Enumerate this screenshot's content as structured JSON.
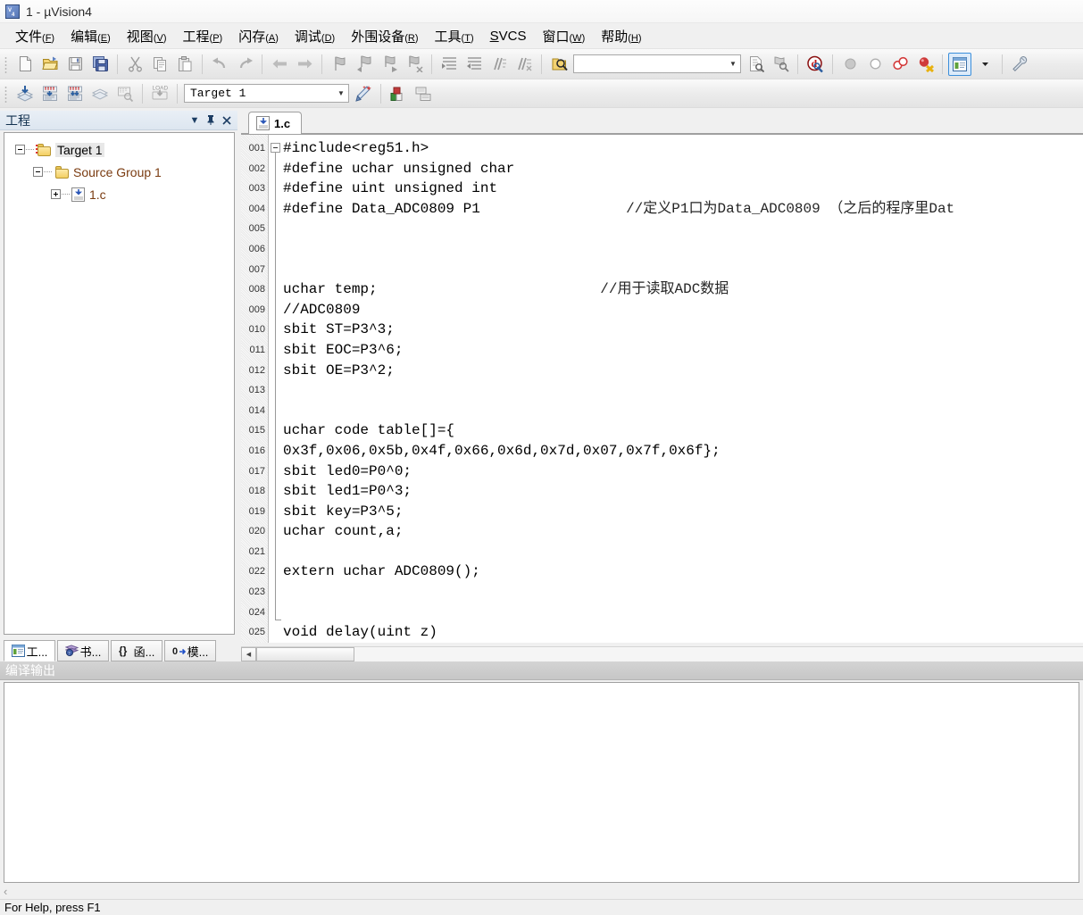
{
  "window": {
    "title": "1 - µVision4",
    "app_icon": "uvision-logo-icon"
  },
  "menubar": [
    {
      "name": "file",
      "label": "文件",
      "key": "F"
    },
    {
      "name": "edit",
      "label": "编辑",
      "key": "E"
    },
    {
      "name": "view",
      "label": "视图",
      "key": "V"
    },
    {
      "name": "project",
      "label": "工程",
      "key": "P"
    },
    {
      "name": "flash",
      "label": "闪存",
      "key": "A"
    },
    {
      "name": "debug",
      "label": "调试",
      "key": "D"
    },
    {
      "name": "peripherals",
      "label": "外围设备",
      "key": "R"
    },
    {
      "name": "tools",
      "label": "工具",
      "key": "T"
    },
    {
      "name": "svcs",
      "label": "SVCS",
      "key": "S",
      "inline_key": true
    },
    {
      "name": "window",
      "label": "窗口",
      "key": "W"
    },
    {
      "name": "help",
      "label": "帮助",
      "key": "H"
    }
  ],
  "toolbar_main": {
    "find_box": {
      "value": "",
      "placeholder": ""
    },
    "selected_button": "target-options-window-button"
  },
  "toolbar_build": {
    "target_combo": {
      "value": "Target 1"
    }
  },
  "project_panel": {
    "caption": "工程",
    "caption_buttons": [
      "dropdown-menu",
      "pin",
      "close"
    ],
    "tree": [
      {
        "label": "Target 1",
        "level": 0,
        "expander": "minus",
        "icon": "target-folder-icon",
        "selected": true
      },
      {
        "label": "Source Group 1",
        "level": 1,
        "expander": "minus",
        "icon": "group-folder-icon",
        "selected": false
      },
      {
        "label": "1.c",
        "level": 2,
        "expander": "plus",
        "icon": "c-source-file-icon",
        "selected": false
      }
    ],
    "tabs": [
      {
        "label": "工...",
        "icon": "project-icon",
        "active": true
      },
      {
        "label": "书...",
        "icon": "books-icon",
        "active": false
      },
      {
        "label": "函...",
        "icon": "functions-icon",
        "active": false
      },
      {
        "label": "模...",
        "icon": "templates-icon",
        "active": false
      }
    ]
  },
  "editor": {
    "tabs": [
      {
        "label": "1.c",
        "icon": "c-source-file-icon",
        "active": true
      }
    ],
    "fold_start_line": 1,
    "fold_end_line": 24,
    "lines": [
      {
        "n": "001",
        "code": "#include<reg51.h>"
      },
      {
        "n": "002",
        "code": "#define uchar unsigned char"
      },
      {
        "n": "003",
        "code": "#define uint unsigned int"
      },
      {
        "n": "004",
        "code": "#define Data_ADC0809 P1",
        "comment": "//定义P1口为Data_ADC0809 （之后的程序里Dat",
        "comment_col": 40
      },
      {
        "n": "005",
        "code": ""
      },
      {
        "n": "006",
        "code": ""
      },
      {
        "n": "007",
        "code": ""
      },
      {
        "n": "008",
        "code": "uchar temp;",
        "comment": "//用于读取ADC数据",
        "comment_col": 37
      },
      {
        "n": "009",
        "code": "//ADC0809"
      },
      {
        "n": "010",
        "code": "sbit ST=P3^3;"
      },
      {
        "n": "011",
        "code": "sbit EOC=P3^6;"
      },
      {
        "n": "012",
        "code": "sbit OE=P3^2;"
      },
      {
        "n": "013",
        "code": ""
      },
      {
        "n": "014",
        "code": ""
      },
      {
        "n": "015",
        "code": "uchar code table[]={"
      },
      {
        "n": "016",
        "code": "0x3f,0x06,0x5b,0x4f,0x66,0x6d,0x7d,0x07,0x7f,0x6f};"
      },
      {
        "n": "017",
        "code": "sbit led0=P0^0;"
      },
      {
        "n": "018",
        "code": "sbit led1=P0^3;"
      },
      {
        "n": "019",
        "code": "sbit key=P3^5;"
      },
      {
        "n": "020",
        "code": "uchar count,a;"
      },
      {
        "n": "021",
        "code": ""
      },
      {
        "n": "022",
        "code": "extern uchar ADC0809();"
      },
      {
        "n": "023",
        "code": ""
      },
      {
        "n": "024",
        "code": ""
      },
      {
        "n": "025",
        "code": "void delay(uint z)"
      }
    ]
  },
  "build_output": {
    "caption": "编译输出",
    "content": "",
    "scroll_marker": "‹"
  },
  "statusbar": {
    "text": "For Help, press F1"
  },
  "colors": {
    "accent_blue": "#3c8fdb",
    "tree_text": "#7a3b10",
    "caption_active_text": "#13314f",
    "build_caption_bg": "#c6c6c6",
    "editor_bg": "#ffffff",
    "gutter_bg": "#e9e9e9"
  }
}
